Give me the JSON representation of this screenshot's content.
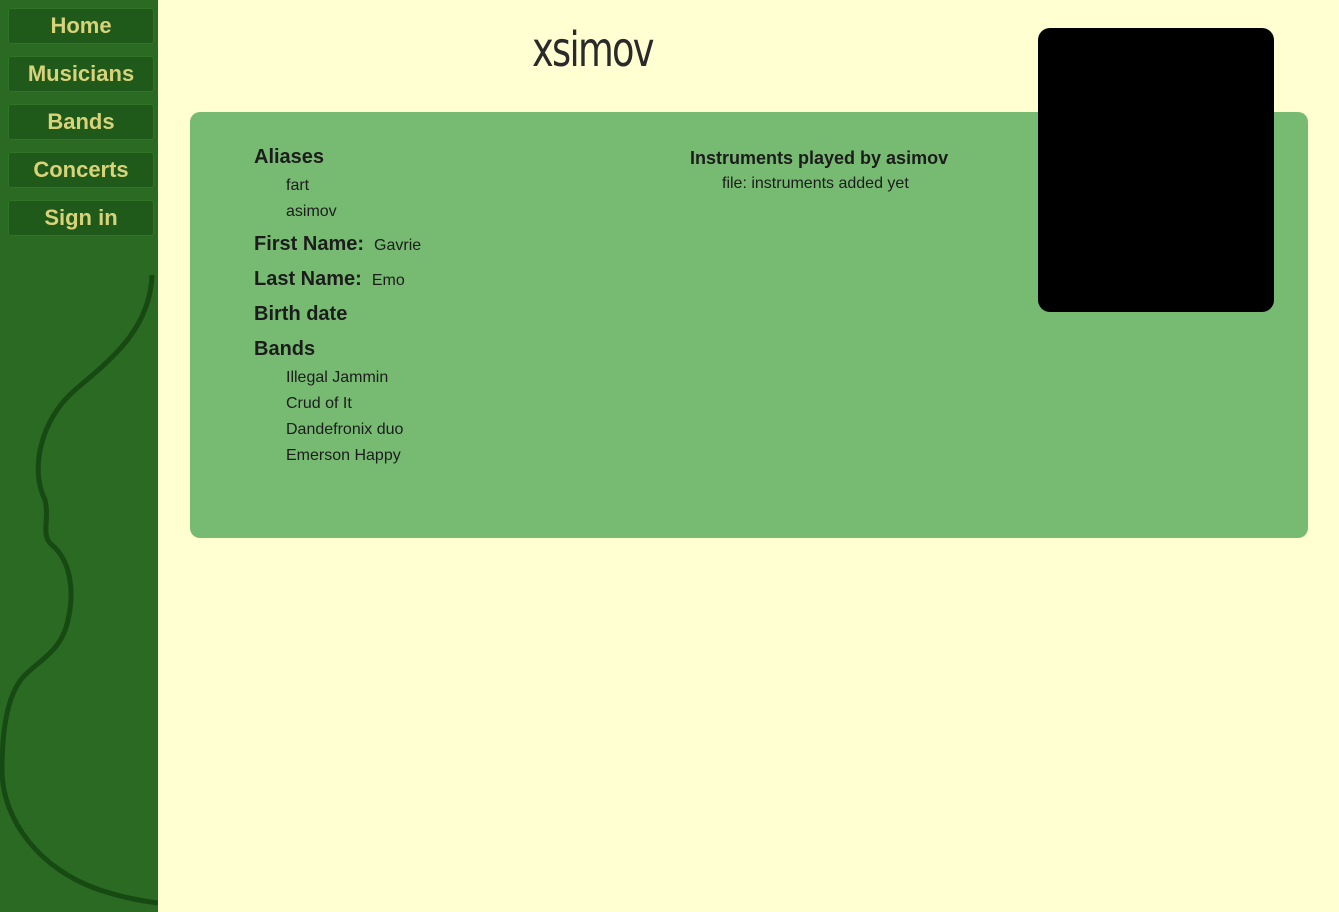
{
  "nav": {
    "items": [
      "Home",
      "Musicians",
      "Bands",
      "Concerts",
      "Sign in"
    ]
  },
  "page": {
    "title": "xsimov"
  },
  "aliases": {
    "label": "Aliases",
    "items": [
      "fart",
      "asimov"
    ]
  },
  "first_name": {
    "label": "First Name:",
    "value": "Gavrie"
  },
  "last_name": {
    "label": "Last Name:",
    "value": "Emo"
  },
  "birth_date": {
    "label": "Birth date",
    "value": ""
  },
  "bands": {
    "label": "Bands",
    "items": [
      "Illegal Jammin",
      "Crud of It",
      "Dandefronix duo",
      "Emerson Happy"
    ]
  },
  "instruments": {
    "title": "Instruments played by asimov",
    "file": "file: instruments added yet"
  },
  "colors": {
    "background": "#ffffd2",
    "sidebar": "#2a6a22",
    "nav_text": "#d8d37a",
    "panel": "#77bb73"
  },
  "icons": {
    "sidebar_decor": "violin-outline-icon"
  }
}
